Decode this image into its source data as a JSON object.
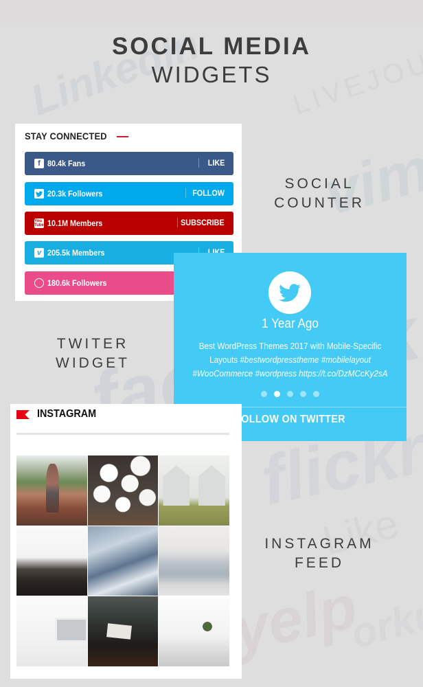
{
  "background_watermarks": [
    "LinkedIn",
    "LIVEJOURNAL",
    "vimeo",
    "facebook",
    "flickr",
    "Like",
    "yelp",
    "orkut"
  ],
  "header": {
    "title_line1": "SOCIAL MEDIA",
    "title_line2": "WIDGETS"
  },
  "labels": {
    "social_counter": [
      "SOCIAL",
      "COUNTER"
    ],
    "twitter_widget": [
      "TWITER",
      "WIDGET"
    ],
    "instagram_feed": [
      "INSTAGRAM",
      "FEED"
    ]
  },
  "social_counter": {
    "heading": "STAY CONNECTED",
    "accent_color": "#cc1e2e",
    "rows": [
      {
        "network": "facebook",
        "icon": "facebook-icon",
        "glyph": "f",
        "count": "80.4k Fans",
        "action": "LIKE",
        "color": "#3b5988"
      },
      {
        "network": "twitter",
        "icon": "twitter-icon",
        "glyph": "🐦",
        "count": "20.3k Followers",
        "action": "FOLLOW",
        "color": "#00a9eb"
      },
      {
        "network": "youtube",
        "icon": "youtube-icon",
        "glyph": "You Tube",
        "count": "10.1M Members",
        "action": "SUBSCRIBE",
        "color": "#bb0000"
      },
      {
        "network": "vimeo",
        "icon": "vimeo-icon",
        "glyph": "v",
        "count": "205.5k Members",
        "action": "LIKE",
        "color": "#18aee1"
      },
      {
        "network": "dribbble",
        "icon": "dribbble-icon",
        "glyph": "",
        "count": "180.6k Followers",
        "action": "",
        "color": "#ea4c89"
      }
    ]
  },
  "twitter_widget": {
    "background_color": "#43caf5",
    "time": "1 Year Ago",
    "tweet_plain": "Best WordPress Themes 2017 with Mobile-Specific Layouts",
    "tweet_hashtags": "#bestwordpresstheme #mobilelayout #WooCommerce #wordpress https://t.co/DzMCcKy2sA",
    "dots_total": 5,
    "dots_active_index": 1,
    "follow_label": "FOLLOW ON TWITTER"
  },
  "instagram": {
    "title": "INSTAGRAM",
    "flag_color": "#e60012",
    "photos": [
      {
        "alt": "Woman standing on red rocks"
      },
      {
        "alt": "White peony flowers on wooden table"
      },
      {
        "alt": "Two white gabled houses with couple"
      },
      {
        "alt": "Minimal kitchen shelf with framed photos"
      },
      {
        "alt": "Aerial view of bridge over river rapids"
      },
      {
        "alt": "White building with fire escape"
      },
      {
        "alt": "White wall with framed prints"
      },
      {
        "alt": "Dark room with desk and papers"
      },
      {
        "alt": "White kitchen with plant in vase"
      }
    ]
  }
}
